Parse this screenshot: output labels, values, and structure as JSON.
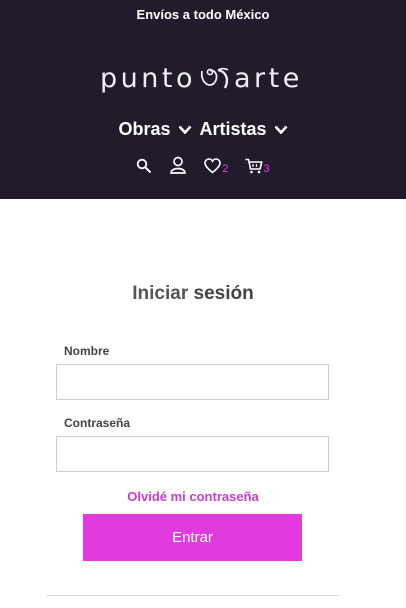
{
  "header": {
    "promo": "Envíos a todo México",
    "logo": {
      "left": "punto",
      "right": "arte",
      "mark": "logo-mark"
    },
    "nav": [
      {
        "label": "Obras",
        "icon": "chevron-down-icon"
      },
      {
        "label": "Artistas",
        "icon": "chevron-down-icon"
      }
    ],
    "icons": {
      "search": "search-icon",
      "account": "user-icon",
      "wishlist": {
        "icon": "heart-icon",
        "count": "2"
      },
      "cart": {
        "icon": "cart-icon",
        "count": "3"
      }
    }
  },
  "login": {
    "title_prefix": "Iniciar ",
    "title_bold": "sesión",
    "name_label": "Nombre",
    "name_value": "",
    "password_label": "Contraseña",
    "password_value": "",
    "forgot": "Olvidé mi contraseña",
    "submit": "Entrar"
  },
  "colors": {
    "header_bg": "#211b2c",
    "accent": "#e13be0",
    "link": "#c93bd0"
  }
}
